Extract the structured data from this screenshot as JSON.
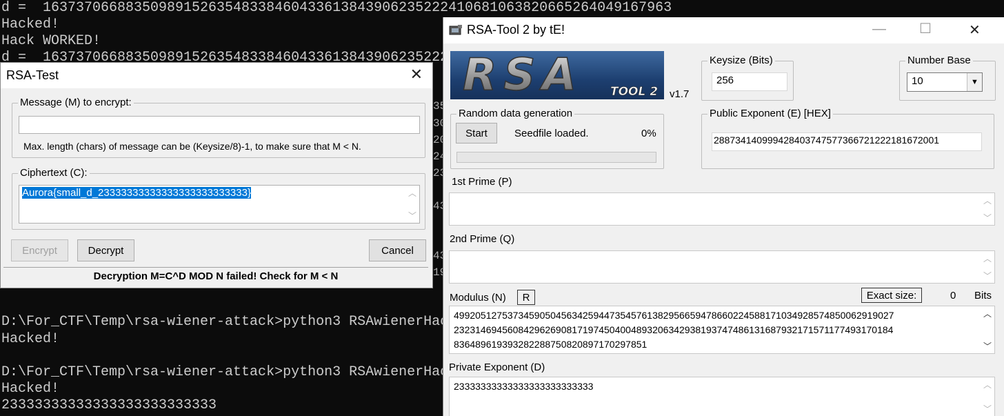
{
  "console": {
    "lines": [
      "d =  1637370668835098915263548338460433613843906235222410681063820665264049167963",
      "Hacked!",
      "Hack WORKED!",
      "d =  16373706688350989152635483384604336138439062352225",
      "D:\\For_CTF\\Temp\\rsa-wiener-attack>python3 RSAwienerHac",
      "Hacked!",
      "D:\\For_CTF\\Temp\\rsa-wiener-attack>python3 RSAwienerHac",
      "Hacked!",
      "23333333333333333333333333"
    ],
    "peek_chars": [
      "35",
      "30",
      "20",
      "24",
      "23",
      "43",
      "43",
      "19"
    ]
  },
  "rsa_test": {
    "title": "RSA-Test",
    "message_group": "Message (M) to encrypt:",
    "message_value": "",
    "hint": "Max. length (chars) of message can be (Keysize/8)-1, to make sure that M < N.",
    "cipher_group": "Ciphertext (C):",
    "cipher_value": "Aurora{small_d_23333333333333333333333333}",
    "encrypt_label": "Encrypt",
    "decrypt_label": "Decrypt",
    "cancel_label": "Cancel",
    "status": "Decryption M=C^D MOD N failed! Check for M < N"
  },
  "rsa_tool": {
    "title": "RSA-Tool 2 by tE!",
    "logo_text": "RSA",
    "logo_sub": "TOOL 2",
    "version": "v1.7",
    "keysize_label": "Keysize (Bits)",
    "keysize_value": "256",
    "number_base_label": "Number Base",
    "number_base_value": "10",
    "random_group": "Random data generation",
    "start_label": "Start",
    "seed_status": "Seedfile loaded.",
    "progress": "0%",
    "progress_value": 0,
    "public_exp_label": "Public Exponent (E) [HEX]",
    "public_exp_value": "288734140999428403747577366721222181672001",
    "prime_p_label": "1st Prime (P)",
    "prime_p_value": "",
    "prime_q_label": "2nd Prime (Q)",
    "prime_q_value": "",
    "modulus_label": "Modulus (N)",
    "r_button": "R",
    "exact_size_label": "Exact size:",
    "exact_size_value": "0",
    "bits_label": "Bits",
    "modulus_lines": [
      "4992051275373459050456342594473545761382956659478660224588171034928574850062919027",
      "2323146945608429626908171974504004893206342938193747486131687932171571177493170184",
      "836489619393282288750820897170297851"
    ],
    "private_exp_label": "Private Exponent (D)",
    "private_exp_value": "23333333333333333333333333"
  }
}
